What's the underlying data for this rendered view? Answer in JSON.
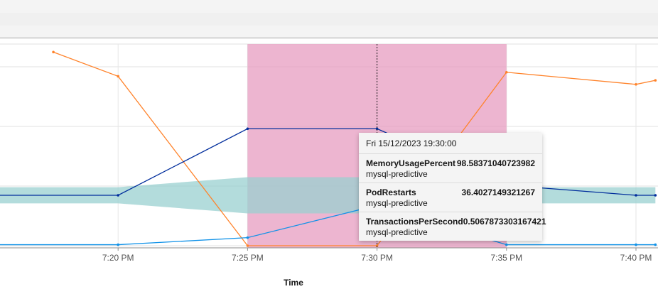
{
  "colors": {
    "metric": "#ff832b",
    "navy": "#002d9c",
    "blue": "#1192e8",
    "band": "#9ad0d0",
    "anomaly": "#e698be"
  },
  "chart_data": {
    "type": "line",
    "xlabel": "Time",
    "ylabel": "",
    "x_ticks": [
      "7:20 PM",
      "7:25 PM",
      "7:30 PM",
      "7:35 PM",
      "7:40 PM"
    ],
    "x_domain": [
      "2023-12-15 19:15",
      "2023-12-15 19:40"
    ],
    "y_domain": [
      0,
      100
    ],
    "grid": true,
    "series": [
      {
        "key": "orange",
        "color": "#ff832b",
        "points": [
          [
            "2023-12-15 19:17:30",
            96
          ],
          [
            "2023-12-15 19:20",
            84
          ],
          [
            "2023-12-15 19:25",
            0
          ],
          [
            "2023-12-15 19:30",
            0
          ],
          [
            "2023-12-15 19:35",
            86
          ],
          [
            "2023-12-15 19:40",
            80
          ],
          [
            "2023-12-15 19:40:45",
            82
          ]
        ]
      },
      {
        "key": "navy",
        "color": "#002d9c",
        "points": [
          [
            "2023-12-15 19:15",
            25
          ],
          [
            "2023-12-15 19:20",
            25
          ],
          [
            "2023-12-15 19:25",
            58
          ],
          [
            "2023-12-15 19:30",
            58
          ],
          [
            "2023-12-15 19:35",
            30
          ],
          [
            "2023-12-15 19:40",
            25
          ],
          [
            "2023-12-15 19:40:45",
            25
          ]
        ]
      },
      {
        "key": "blue",
        "color": "#1192e8",
        "points": [
          [
            "2023-12-15 19:15",
            0.5
          ],
          [
            "2023-12-15 19:20",
            0.5
          ],
          [
            "2023-12-15 19:25",
            4
          ],
          [
            "2023-12-15 19:30",
            20
          ],
          [
            "2023-12-15 19:35",
            0.5
          ],
          [
            "2023-12-15 19:40",
            0.5
          ],
          [
            "2023-12-15 19:40:45",
            0.5
          ]
        ]
      }
    ],
    "confidence_band": [
      [
        "2023-12-15 19:15",
        21,
        29
      ],
      [
        "2023-12-15 19:20",
        21,
        29
      ],
      [
        "2023-12-15 19:25",
        16,
        34
      ],
      [
        "2023-12-15 19:30",
        16,
        34
      ],
      [
        "2023-12-15 19:35",
        21,
        29
      ],
      [
        "2023-12-15 19:40",
        21,
        29
      ],
      [
        "2023-12-15 19:40:45",
        21,
        29
      ]
    ],
    "anomaly_range": [
      "2023-12-15 19:25",
      "2023-12-15 19:35"
    ],
    "hover_time": "2023-12-15 19:30"
  },
  "tooltip": {
    "date": "Fri 15/12/2023 19:30:00",
    "rows": [
      {
        "metric": "MemoryUsagePercent",
        "value": "98.58371040723982",
        "group": "mysql-predictive"
      },
      {
        "metric": "PodRestarts",
        "value": "36.4027149321267",
        "group": "mysql-predictive"
      },
      {
        "metric": "TransactionsPerSecond",
        "value": "0.5067873303167421",
        "group": "mysql-predictive"
      }
    ]
  }
}
